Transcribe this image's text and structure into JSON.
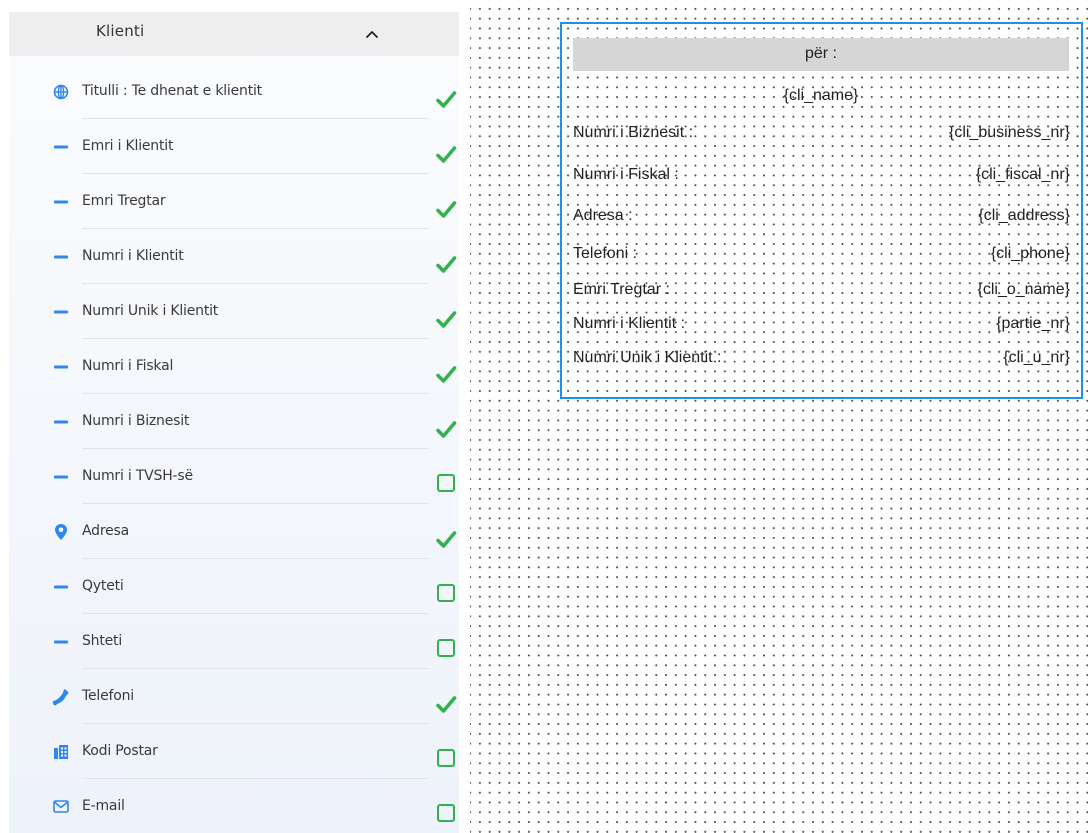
{
  "sidebar": {
    "title": "Klienti",
    "items": [
      {
        "label": "Titulli : Te dhenat e klientit",
        "icon": "globe-icon",
        "checked": true
      },
      {
        "label": "Emri i Klientit",
        "icon": "dash-icon",
        "checked": true
      },
      {
        "label": "Emri Tregtar",
        "icon": "dash-icon",
        "checked": true
      },
      {
        "label": "Numri i Klientit",
        "icon": "dash-icon",
        "checked": true
      },
      {
        "label": "Numri Unik i Klientit",
        "icon": "dash-icon",
        "checked": true
      },
      {
        "label": "Numri i Fiskal",
        "icon": "dash-icon",
        "checked": true
      },
      {
        "label": "Numri i Biznesit",
        "icon": "dash-icon",
        "checked": true
      },
      {
        "label": "Numri i TVSH-së",
        "icon": "dash-icon",
        "checked": false
      },
      {
        "label": "Adresa",
        "icon": "location-pin-icon",
        "checked": true
      },
      {
        "label": "Qyteti",
        "icon": "dash-icon",
        "checked": false
      },
      {
        "label": "Shteti",
        "icon": "dash-icon",
        "checked": false
      },
      {
        "label": "Telefoni",
        "icon": "phone-icon",
        "checked": true
      },
      {
        "label": "Kodi Postar",
        "icon": "building-icon",
        "checked": false
      },
      {
        "label": "E-mail",
        "icon": "envelope-icon",
        "checked": false
      }
    ]
  },
  "template": {
    "header": "për :",
    "client_name": "{cli_name}",
    "rows": [
      {
        "label": "Numri i Biznesit :",
        "value": "{cli_business_nr}"
      },
      {
        "label": "Numri i Fiskal :",
        "value": "{cli_fiscal_nr}"
      },
      {
        "label": "Adresa :",
        "value": "{cli_address}"
      },
      {
        "label": "Telefoni :",
        "value": "{cli_phone}"
      },
      {
        "label": "Emri Tregtar :",
        "value": "{cli_o_name}"
      },
      {
        "label": "Numri i Klientit :",
        "value": "{partie_nr}"
      },
      {
        "label": "Numri Unik i Klientit :",
        "value": "{cli_u_nr}"
      }
    ]
  },
  "colors": {
    "accent_blue": "#1f8ef1",
    "check_green": "#33b14f",
    "icon_blue": "#2f86eb"
  }
}
